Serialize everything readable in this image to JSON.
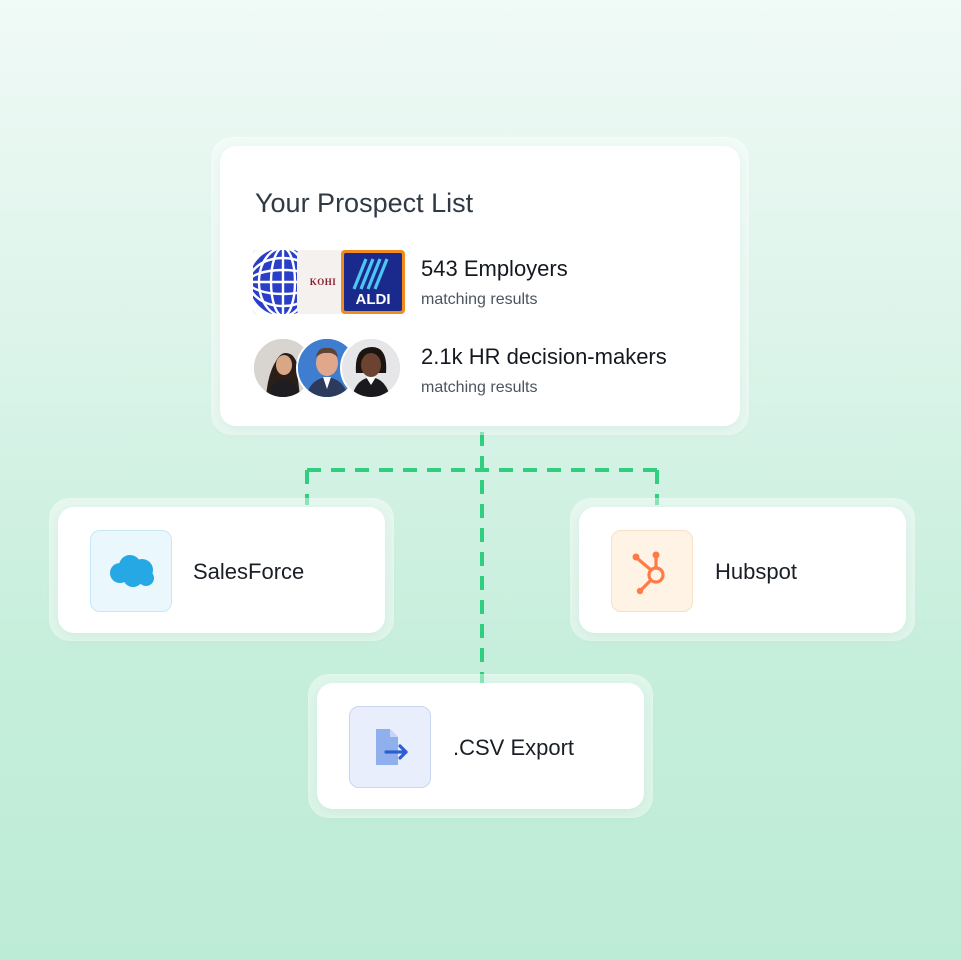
{
  "prospect": {
    "title": "Your Prospect List",
    "employers": {
      "headline": "543 Employers",
      "sub": "matching results",
      "logos": [
        {
          "name": "united-globe-logo"
        },
        {
          "name": "kohls-logo",
          "text": "KOHI"
        },
        {
          "name": "aldi-logo",
          "text": "ALDI"
        }
      ]
    },
    "decision_makers": {
      "headline": "2.1k HR decision-makers",
      "sub": "matching results"
    }
  },
  "destinations": {
    "salesforce": {
      "label": "SalesForce",
      "icon": "salesforce-cloud-icon"
    },
    "hubspot": {
      "label": "Hubspot",
      "icon": "hubspot-sprocket-icon"
    },
    "csv": {
      "label": ".CSV Export",
      "icon": "file-export-icon"
    }
  },
  "colors": {
    "connector": "#2fcf7f",
    "salesforce": "#26a8e4",
    "hubspot": "#ff7a45",
    "csv": "#5a86d8",
    "aldi_navy": "#1a2a8c",
    "aldi_orange": "#f08c1e"
  }
}
